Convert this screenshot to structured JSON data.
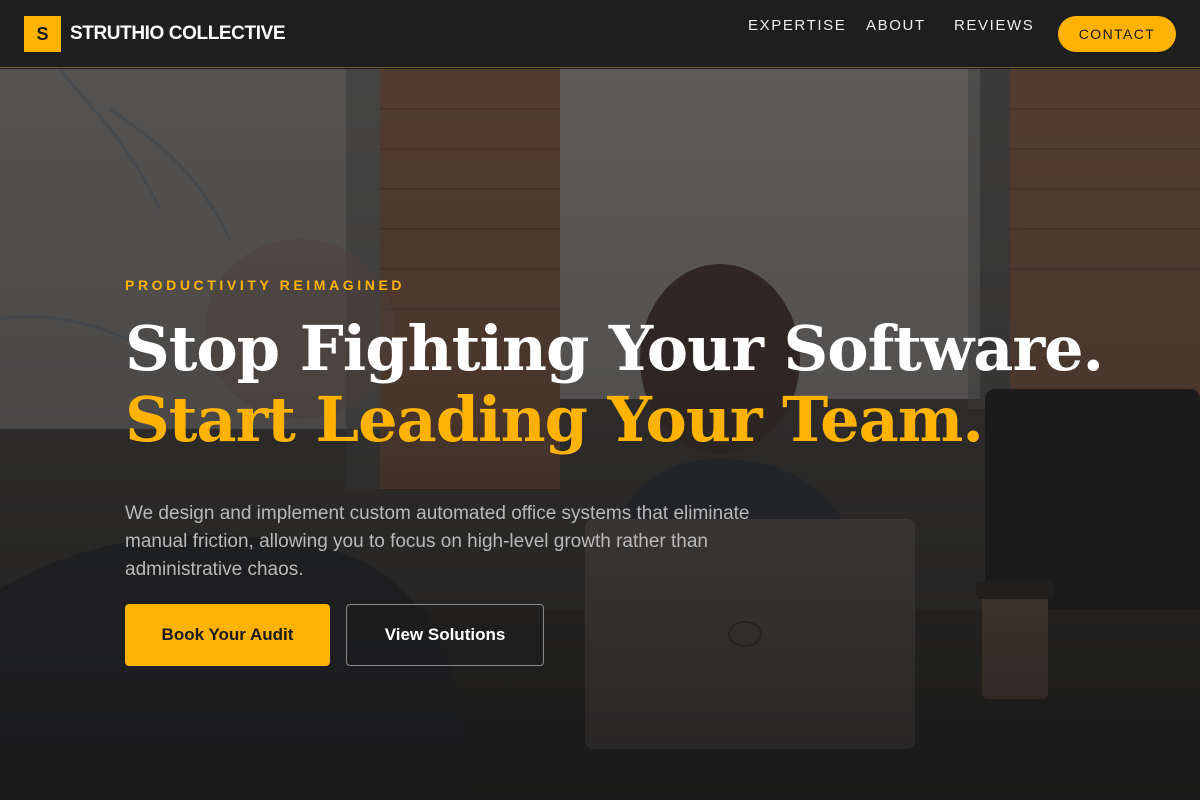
{
  "header": {
    "logo_mark": "S",
    "brand_name": "STRUTHIO COLLECTIVE",
    "nav": {
      "expertise": "EXPERTISE",
      "about": "ABOUT",
      "reviews": "REVIEWS",
      "contact": "CONTACT"
    }
  },
  "hero": {
    "eyebrow": "PRODUCTIVITY REIMAGINED",
    "headline_line1": "Stop Fighting Your Software.",
    "headline_line2": "Start Leading Your Team.",
    "subtext": "We design and implement custom automated office systems that eliminate manual friction, allowing you to focus on high-level growth rather than administrative chaos.",
    "primary_cta": "Book Your Audit",
    "secondary_cta": "View Solutions",
    "background_image": "office-meeting-photo"
  },
  "colors": {
    "accent": "#ffb300",
    "navbar_bg": "#1e1e1e",
    "page_bg": "#1f1f1f",
    "headline_white": "#ffffff",
    "body_text": "#b9b9b9"
  }
}
